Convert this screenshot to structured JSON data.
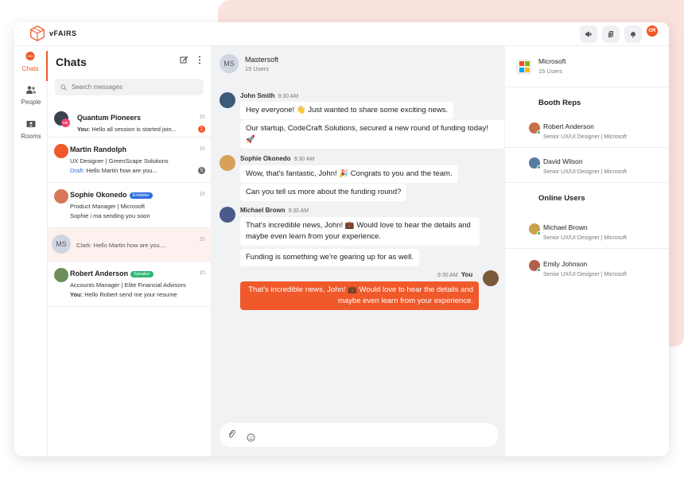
{
  "brand": {
    "name": "vFAIRS",
    "accent": "#f0592a"
  },
  "topbar": {
    "icons": [
      "megaphone-icon",
      "document-icon",
      "bell-icon"
    ],
    "avatar_initials": "OR"
  },
  "leftnav": {
    "items": [
      {
        "label": "Chats",
        "icon": "chat-icon",
        "active": true
      },
      {
        "label": "People",
        "icon": "people-icon",
        "active": false
      },
      {
        "label": "Rooms",
        "icon": "rooms-icon",
        "active": false
      }
    ]
  },
  "chatlist": {
    "title": "Chats",
    "search_placeholder": "Search messages",
    "items": [
      {
        "name": "Quantum Pioneers",
        "line1": "",
        "preview_prefix": "You:",
        "preview": "Hello all session is started join...",
        "time": "1h",
        "badge": "1",
        "badge_color": "#f0592a",
        "tag": ""
      },
      {
        "name": "Martin Randolph",
        "line1": "UX Designer | GreenScape Solutions",
        "preview_prefix": "Draft:",
        "preview": "Hello Martin how are you...",
        "time": "1h",
        "badge": "5",
        "badge_color": "#6b6b6b",
        "tag": ""
      },
      {
        "name": "Sophie Okonedo",
        "line1": "Product Manager | Microsoft",
        "preview_prefix": "",
        "preview": "Sophie i ma sending you soon",
        "time": "1h",
        "badge": "",
        "badge_color": "",
        "tag": "Exhibitor",
        "tag_color": "#2f6fe0"
      },
      {
        "name": "",
        "line1": "",
        "preview_prefix": "",
        "preview": "Clark: Hello Martin how are you....",
        "time": "1h",
        "badge": "",
        "badge_color": "",
        "tag": "",
        "initials": "MS"
      },
      {
        "name": "Robert Anderson",
        "line1": "Accounts Manager | Elite Financial Advisors",
        "preview_prefix": "You:",
        "preview": "Hello Robert send me your resume",
        "time": "1h",
        "badge": "",
        "badge_color": "",
        "tag": "Speaker",
        "tag_color": "#2bb673"
      }
    ]
  },
  "conversation": {
    "title": "Mastersoft",
    "subtitle": "15 Users",
    "initials": "MS",
    "messages": [
      {
        "sender": "John Smith",
        "time": "9:30 AM",
        "bubbles": [
          "Hey everyone! 👋 Just wanted to share some exciting news.",
          "Our startup, CodeCraft Solutions, secured a new round of funding today! 🚀"
        ]
      },
      {
        "sender": "Sophie Okonedo",
        "time": "9:30 AM",
        "bubbles": [
          "Wow, that's fantastic, John! 🎉 Congrats to you and the team.",
          "Can you tell us more about the funding round?"
        ]
      },
      {
        "sender": "Michael Brown",
        "time": "9:30 AM",
        "bubbles": [
          "That's incredible news, John! 💼 Would love to hear the details and maybe even learn from your experience.",
          "Funding is something we're gearing up for as well."
        ]
      },
      {
        "sender": "You",
        "time": "9:30 AM",
        "bubbles": [
          "That's incredible news, John! 💼 Would love to hear the details and maybe even learn from your experience."
        ]
      }
    ],
    "composer_icons": [
      "paperclip-icon",
      "emoji-icon"
    ]
  },
  "rpanel": {
    "title": "Microsoft",
    "subtitle": "15 Users",
    "booth_reps_title": "Booth Reps",
    "online_users_title": "Online Users",
    "booth_reps": [
      {
        "name": "Robert Anderson",
        "role": "Senior UX/UI Designer | Microsoft"
      },
      {
        "name": "David Wilson",
        "role": "Senior UX/UI Designer | Microsoft"
      }
    ],
    "online_users": [
      {
        "name": "Michael Brown",
        "role": "Senior UX/UI Designer | Microsoft"
      },
      {
        "name": "Emily Johnson",
        "role": "Senior UX/UI Designer | Microsoft"
      }
    ]
  }
}
